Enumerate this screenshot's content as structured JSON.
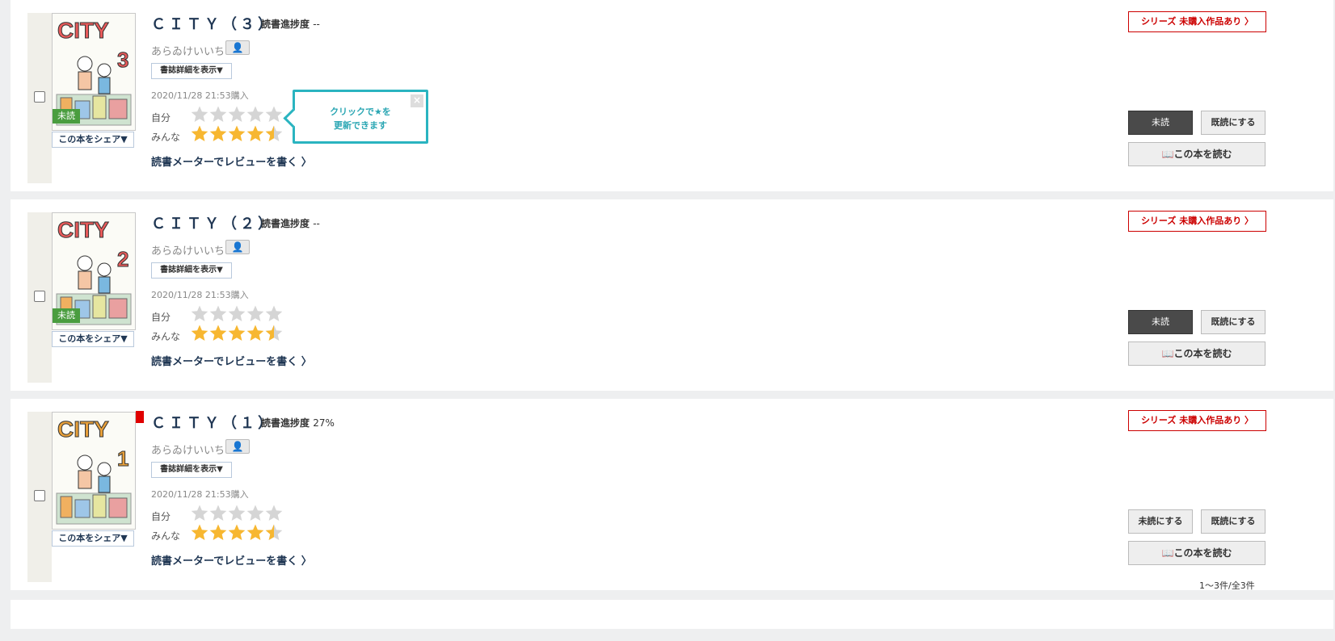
{
  "books": [
    {
      "title": "ＣＩＴＹ（３）",
      "progress_label": "読書進捗度",
      "progress_value": "--",
      "author": "あらゐけいいち",
      "author_icon": "person-book-icon",
      "detail_label": "書誌詳細を表示▼",
      "purchase_date": "2020/11/28 21:53購入",
      "self_label": "自分",
      "all_label": "みんな",
      "self_rating": 0,
      "all_rating": 4.5,
      "review_label": "読書メーターでレビューを書く 〉",
      "series_label": "シリーズ 未購入作品あり 〉",
      "status_label": "未読",
      "status_active": true,
      "read_label": "既読にする",
      "open_label": "📖この本を読む",
      "share_label": "この本をシェア▼",
      "badge": "未読",
      "cover_volume": "3",
      "cover_title": "CITY",
      "cover_color": "#e85a5a"
    },
    {
      "title": "ＣＩＴＹ（２）",
      "progress_label": "読書進捗度",
      "progress_value": "--",
      "author": "あらゐけいいち",
      "author_icon": "person-book-icon",
      "detail_label": "書誌詳細を表示▼",
      "purchase_date": "2020/11/28 21:53購入",
      "self_label": "自分",
      "all_label": "みんな",
      "self_rating": 0,
      "all_rating": 4.5,
      "review_label": "読書メーターでレビューを書く 〉",
      "series_label": "シリーズ 未購入作品あり 〉",
      "status_label": "未読",
      "status_active": true,
      "read_label": "既読にする",
      "open_label": "📖この本を読む",
      "share_label": "この本をシェア▼",
      "badge": "未読",
      "cover_volume": "2",
      "cover_title": "CITY",
      "cover_color": "#e85a5a"
    },
    {
      "title": "ＣＩＴＹ（１）",
      "progress_label": "読書進捗度",
      "progress_value": "27%",
      "author": "あらゐけいいち",
      "author_icon": "person-book-icon",
      "detail_label": "書誌詳細を表示▼",
      "purchase_date": "2020/11/28 21:53購入",
      "self_label": "自分",
      "all_label": "みんな",
      "self_rating": 0,
      "all_rating": 4.5,
      "review_label": "読書メーターでレビューを書く 〉",
      "series_label": "シリーズ 未購入作品あり 〉",
      "status_label": "未読にする",
      "status_active": false,
      "read_label": "既読にする",
      "open_label": "📖この本を読む",
      "share_label": "この本をシェア▼",
      "badge": "",
      "cover_volume": "1",
      "cover_title": "CITY",
      "cover_color": "#e8a03a"
    }
  ],
  "tooltip": {
    "line1": "クリックで★を",
    "line2": "更新できます",
    "close": "×"
  },
  "pagination": {
    "count": "1〜3件/全3件"
  },
  "colors": {
    "star_filled": "#f7b731",
    "star_empty": "#d5d5d5",
    "series_red": "#cc0000",
    "tooltip_teal": "#2ab4c0"
  }
}
